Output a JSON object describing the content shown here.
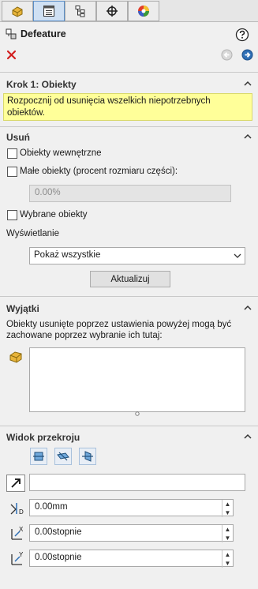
{
  "tabs": [
    {
      "name": "featuremanager",
      "icon": "part-icon",
      "active": false
    },
    {
      "name": "propertymanager",
      "icon": "property-list-icon",
      "active": true
    },
    {
      "name": "configurationmanager",
      "icon": "configuration-icon",
      "active": false
    },
    {
      "name": "dimxpert",
      "icon": "crosshair-icon",
      "active": false
    },
    {
      "name": "display",
      "icon": "appearance-icon",
      "active": false
    }
  ],
  "header": {
    "title": "Defeature",
    "help_icon": "help-icon",
    "cancel_icon": "close-icon"
  },
  "step": {
    "title": "Krok 1: Obiekty",
    "message": "Rozpocznij od usunięcia wszelkich niepotrzebnych obiektów."
  },
  "remove": {
    "title": "Usuń",
    "internal_label": "Obiekty wewnętrzne",
    "small_label": "Małe obiekty (procent rozmiaru części):",
    "small_value": "0.00%",
    "selected_label": "Wybrane obiekty",
    "display_label": "Wyświetlanie",
    "display_value": "Pokaż wszystkie",
    "update_label": "Aktualizuj"
  },
  "exceptions": {
    "title": "Wyjątki",
    "description": "Obiekty usunięte poprzez ustawienia powyżej mogą być zachowane poprzez wybranie ich tutaj:"
  },
  "section_view": {
    "title": "Widok przekroju",
    "plane_value": "",
    "offset_value": "0.00mm",
    "rotate_x_value": "0.00stopnie",
    "rotate_y_value": "0.00stopnie"
  },
  "colors": {
    "accent": "#5b8ec6",
    "message_bg": "#ffff99",
    "cancel": "#d21f1f"
  }
}
